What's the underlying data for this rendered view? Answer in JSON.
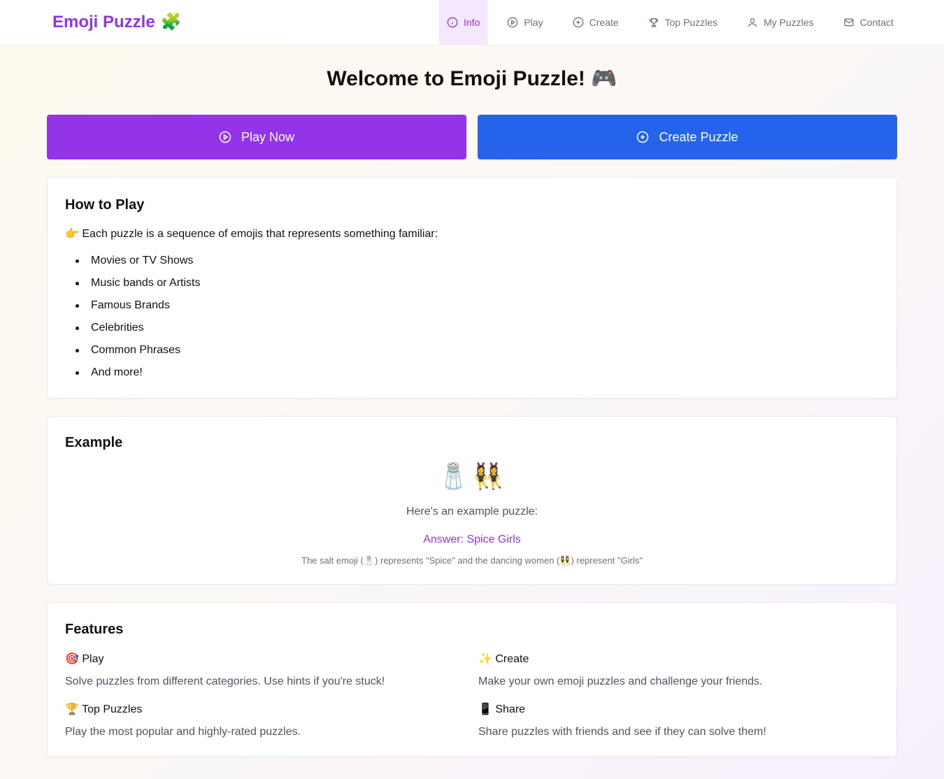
{
  "brand": {
    "name": "Emoji Puzzle",
    "icon": "🧩"
  },
  "nav": {
    "items": [
      {
        "label": "Info",
        "icon": "info-icon",
        "active": true
      },
      {
        "label": "Play",
        "icon": "play-circle-icon"
      },
      {
        "label": "Create",
        "icon": "plus-circle-icon"
      },
      {
        "label": "Top Puzzles",
        "icon": "trophy-icon"
      },
      {
        "label": "My Puzzles",
        "icon": "user-icon"
      },
      {
        "label": "Contact",
        "icon": "mail-icon"
      }
    ]
  },
  "page_title": "Welcome to Emoji Puzzle! 🎮",
  "actions": {
    "play_label": "Play Now",
    "create_label": "Create Puzzle"
  },
  "how_to_play": {
    "title": "How to Play",
    "intro": "👉 Each puzzle is a sequence of emojis that represents something familiar:",
    "items": [
      "Movies or TV Shows",
      "Music bands or Artists",
      "Famous Brands",
      "Celebrities",
      "Common Phrases",
      "And more!"
    ]
  },
  "example": {
    "title": "Example",
    "emojis": "🧂👯‍♀️",
    "lead": "Here's an example puzzle:",
    "answer": "Answer: Spice Girls",
    "explanation": "The salt emoji (🧂) represents \"Spice\" and the dancing women (👯‍♀️) represent \"Girls\""
  },
  "features": {
    "title": "Features",
    "items": [
      {
        "title": "🎯 Play",
        "desc": "Solve puzzles from different categories. Use hints if you're stuck!"
      },
      {
        "title": "✨ Create",
        "desc": "Make your own emoji puzzles and challenge your friends."
      },
      {
        "title": "🏆 Top Puzzles",
        "desc": "Play the most popular and highly-rated puzzles."
      },
      {
        "title": "📱 Share",
        "desc": "Share puzzles with friends and see if they can solve them!"
      }
    ]
  },
  "colors": {
    "purple": "#9333ea",
    "blue": "#2563eb",
    "active_bg": "#f3e8ff"
  }
}
